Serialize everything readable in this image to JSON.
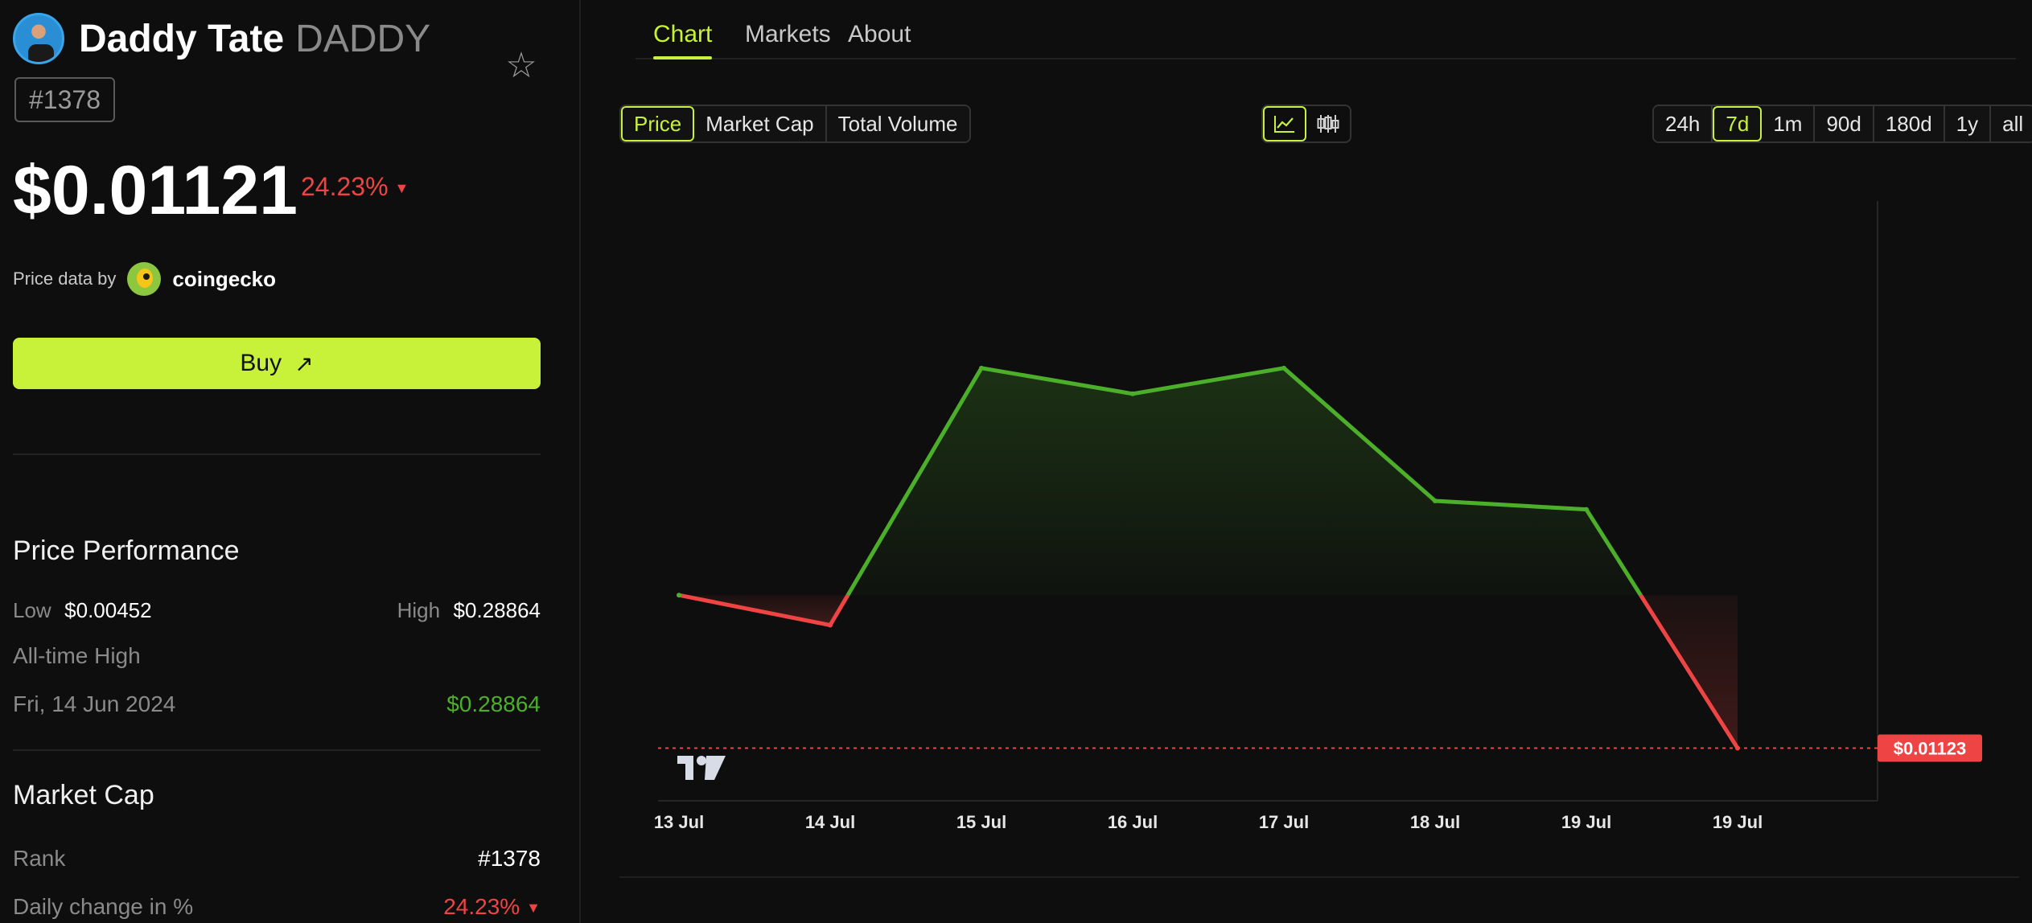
{
  "coin": {
    "name": "Daddy Tate",
    "symbol": "DADDY",
    "rank": "#1378",
    "price": "$0.01121",
    "change_24h": "24.23%",
    "price_data_by": "Price data by",
    "data_provider": "coingecko",
    "buy_label": "Buy"
  },
  "performance": {
    "title": "Price Performance",
    "low_label": "Low",
    "low_value": "$0.00452",
    "high_label": "High",
    "high_value": "$0.28864",
    "ath_label": "All-time High",
    "ath_date": "Fri, 14 Jun 2024",
    "ath_value": "$0.28864"
  },
  "market_cap": {
    "title": "Market Cap",
    "rank_label": "Rank",
    "rank_value": "#1378",
    "daily_change_label": "Daily change in %",
    "daily_change_value": "24.23%"
  },
  "tabs": [
    {
      "label": "Chart"
    },
    {
      "label": "Markets"
    },
    {
      "label": "About"
    }
  ],
  "metric_buttons": [
    {
      "label": "Price"
    },
    {
      "label": "Market Cap"
    },
    {
      "label": "Total Volume"
    }
  ],
  "range_buttons": [
    {
      "label": "24h"
    },
    {
      "label": "7d"
    },
    {
      "label": "1m"
    },
    {
      "label": "90d"
    },
    {
      "label": "180d"
    },
    {
      "label": "1y"
    },
    {
      "label": "all"
    }
  ],
  "icons": {
    "star": "star-icon",
    "buy_arrow": "arrow-up-right-icon",
    "line_chart": "line-chart-icon",
    "candles": "candlestick-icon",
    "tradingview": "tradingview-logo"
  },
  "colors": {
    "accent": "#c8f23a",
    "up": "#4caf2a",
    "down": "#ef4444"
  },
  "chart_data": {
    "type": "line",
    "categories": [
      "13 Jul",
      "14 Jul",
      "15 Jul",
      "16 Jul",
      "17 Jul",
      "18 Jul",
      "19 Jul",
      "19 Jul"
    ],
    "values": [
      0.0148,
      0.0141,
      0.0201,
      0.0195,
      0.0201,
      0.017,
      0.0168,
      0.01123
    ],
    "baseline": 0.0148,
    "last_value_label": "$0.01123",
    "ylim": [
      0.01,
      0.024
    ]
  }
}
